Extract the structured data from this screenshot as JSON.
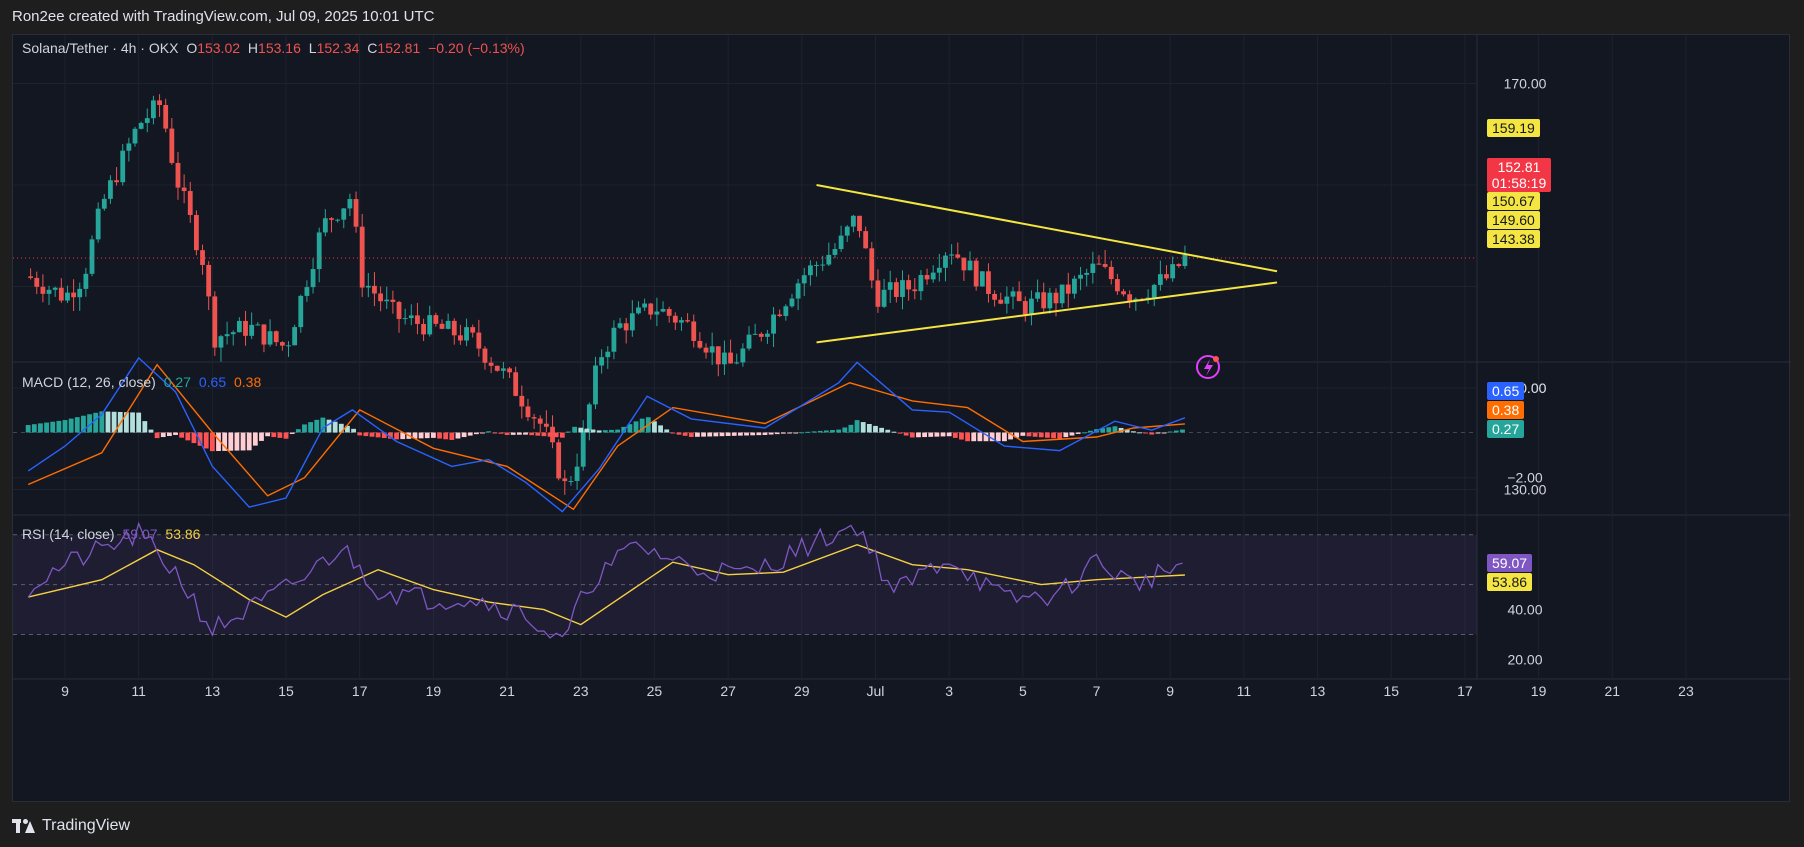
{
  "header": {
    "attribution": "Ron2ee created with TradingView.com, Jul 09, 2025 10:01 UTC"
  },
  "legend": {
    "symbol": "Solana/Tether · 4h · OKX",
    "o_label": "O",
    "o": "153.02",
    "h_label": "H",
    "h": "153.16",
    "l_label": "L",
    "l": "152.34",
    "c_label": "C",
    "c": "152.81",
    "change": "−0.20 (−0.13%)"
  },
  "macd_legend": {
    "name": "MACD (12, 26, close)",
    "hist": "0.27",
    "macd": "0.65",
    "signal": "0.38"
  },
  "rsi_legend": {
    "name": "RSI (14, close)",
    "rsi": "59.07",
    "ma": "53.86"
  },
  "price_badges": {
    "level_159": "159.19",
    "last": "152.81",
    "countdown": "01:58:19",
    "level_150": "150.67",
    "level_149": "149.60",
    "level_143": "143.38"
  },
  "macd_badges": {
    "macd": "0.65",
    "signal": "0.38",
    "hist": "0.27"
  },
  "rsi_badges": {
    "rsi": "59.07",
    "ma": "53.86"
  },
  "footer": {
    "brand": "TradingView"
  },
  "colors": {
    "up": "#26a69a",
    "down": "#ef5350",
    "triangle": "#f5e542",
    "macd": "#2962ff",
    "signal": "#ff6d00",
    "rsi": "#7e57c2",
    "rsi_ma": "#f5d142",
    "hist_up_strong": "#26a69a",
    "hist_up_weak": "#b2dfdb",
    "hist_down_strong": "#ff5252",
    "hist_down_weak": "#ffcdd2"
  },
  "chart_data": [
    {
      "type": "candlestick",
      "title": "Solana/Tether · 4h · OKX",
      "x_ticks": [
        "9",
        "11",
        "13",
        "15",
        "17",
        "19",
        "21",
        "23",
        "25",
        "27",
        "29",
        "Jul",
        "3",
        "5",
        "7",
        "9",
        "11",
        "13",
        "15",
        "17",
        "19",
        "21",
        "23"
      ],
      "y_ticks": [
        130,
        140,
        150,
        160,
        170
      ],
      "y_tick_labels": [
        "130.00",
        "140.00",
        "",
        "",
        "170.00"
      ],
      "ylim": [
        123.5,
        173
      ],
      "approx_close_path": [
        {
          "x": "Jun 8",
          "close": 151
        },
        {
          "x": "Jun 9",
          "close": 149
        },
        {
          "x": "Jun 9.5",
          "close": 151
        },
        {
          "x": "Jun 10",
          "close": 158
        },
        {
          "x": "Jun 11",
          "close": 166
        },
        {
          "x": "Jun 11.6",
          "close": 168
        },
        {
          "x": "Jun 12",
          "close": 161
        },
        {
          "x": "Jun 12.8",
          "close": 152
        },
        {
          "x": "Jun 13",
          "close": 145
        },
        {
          "x": "Jun 14",
          "close": 146
        },
        {
          "x": "Jun 15",
          "close": 144
        },
        {
          "x": "Jun 16",
          "close": 156
        },
        {
          "x": "Jun 16.8",
          "close": 159
        },
        {
          "x": "Jun 17",
          "close": 151
        },
        {
          "x": "Jun 18",
          "close": 147
        },
        {
          "x": "Jun 19",
          "close": 146
        },
        {
          "x": "Jun 20",
          "close": 145
        },
        {
          "x": "Jun 21",
          "close": 141
        },
        {
          "x": "Jun 22",
          "close": 136
        },
        {
          "x": "Jun 22.6",
          "close": 130
        },
        {
          "x": "Jun 23",
          "close": 134
        },
        {
          "x": "Jun 23.5",
          "close": 143
        },
        {
          "x": "Jun 24",
          "close": 146
        },
        {
          "x": "Jun 25",
          "close": 148
        },
        {
          "x": "Jun 26",
          "close": 146
        },
        {
          "x": "Jun 27",
          "close": 142
        },
        {
          "x": "Jun 28",
          "close": 146
        },
        {
          "x": "Jun 29",
          "close": 151
        },
        {
          "x": "Jun 30",
          "close": 154
        },
        {
          "x": "Jun 30.5",
          "close": 157
        },
        {
          "x": "Jul 1",
          "close": 149
        },
        {
          "x": "Jul 2",
          "close": 150
        },
        {
          "x": "Jul 3",
          "close": 154
        },
        {
          "x": "Jul 4",
          "close": 150
        },
        {
          "x": "Jul 5",
          "close": 148
        },
        {
          "x": "Jul 6",
          "close": 149
        },
        {
          "x": "Jul 7",
          "close": 152
        },
        {
          "x": "Jul 8",
          "close": 149
        },
        {
          "x": "Jul 9",
          "close": 151
        },
        {
          "x": "Jul 9.4",
          "close": 152.81
        }
      ],
      "trendlines": [
        {
          "name": "triangle-upper",
          "from": {
            "x": "Jun 29.4",
            "y": 160
          },
          "to": {
            "x": "Jul 11.9",
            "y": 151.5
          }
        },
        {
          "name": "triangle-lower",
          "from": {
            "x": "Jun 29.4",
            "y": 144.5
          },
          "to": {
            "x": "Jul 11.9",
            "y": 150.4
          }
        }
      ]
    },
    {
      "type": "line",
      "title": "MACD (12, 26, close)",
      "y_ticks": [
        0,
        -2
      ],
      "y_tick_labels": [
        "",
        "−2.00"
      ],
      "ylim": [
        -3.55,
        3.3
      ],
      "series": [
        {
          "name": "MACD",
          "values_path": [
            [
              -1.7,
              "Jun 8"
            ],
            [
              -0.6,
              "Jun 9"
            ],
            [
              0.8,
              "Jun 10"
            ],
            [
              3.3,
              "Jun 11"
            ],
            [
              1.8,
              "Jun 12"
            ],
            [
              -1.5,
              "Jun 13"
            ],
            [
              -3.3,
              "Jun 14"
            ],
            [
              -2.9,
              "Jun 15"
            ],
            [
              0.2,
              "Jun 16"
            ],
            [
              1.0,
              "Jun 16.8"
            ],
            [
              -0.4,
              "Jun 18"
            ],
            [
              -1.5,
              "Jun 19.5"
            ],
            [
              -1.2,
              "Jun 20.5"
            ],
            [
              -2.2,
              "Jun 21.5"
            ],
            [
              -3.5,
              "Jun 22.5"
            ],
            [
              -1.6,
              "Jun 23.5"
            ],
            [
              1.6,
              "Jun 24.8"
            ],
            [
              0.6,
              "Jun 26"
            ],
            [
              0.2,
              "Jun 28"
            ],
            [
              2.2,
              "Jun 30"
            ],
            [
              3.1,
              "Jun 30.5"
            ],
            [
              1.0,
              "Jul 2"
            ],
            [
              0.9,
              "Jul 3"
            ],
            [
              -0.6,
              "Jul 4.5"
            ],
            [
              -0.8,
              "Jul 6"
            ],
            [
              0.5,
              "Jul 7.5"
            ],
            [
              0.1,
              "Jul 8.5"
            ],
            [
              0.65,
              "Jul 9.4"
            ]
          ]
        },
        {
          "name": "Signal",
          "values_path": [
            [
              -2.3,
              "Jun 8"
            ],
            [
              -0.9,
              "Jun 10"
            ],
            [
              3.0,
              "Jun 11.5"
            ],
            [
              0.0,
              "Jun 13"
            ],
            [
              -2.8,
              "Jun 14.5"
            ],
            [
              -2.0,
              "Jun 15.5"
            ],
            [
              1.0,
              "Jun 17"
            ],
            [
              -0.7,
              "Jun 19"
            ],
            [
              -1.5,
              "Jun 21"
            ],
            [
              -3.4,
              "Jun 22.8"
            ],
            [
              -0.6,
              "Jun 24"
            ],
            [
              1.1,
              "Jun 25.5"
            ],
            [
              0.4,
              "Jun 28"
            ],
            [
              2.2,
              "Jun 30.3"
            ],
            [
              1.4,
              "Jul 2"
            ],
            [
              1.1,
              "Jul 3.5"
            ],
            [
              -0.4,
              "Jul 5"
            ],
            [
              -0.2,
              "Jul 7"
            ],
            [
              0.2,
              "Jul 8"
            ],
            [
              0.38,
              "Jul 9.4"
            ]
          ]
        }
      ]
    },
    {
      "type": "line",
      "title": "RSI (14, close)",
      "y_ticks": [
        20,
        40
      ],
      "y_tick_labels": [
        "20.00",
        "40.00"
      ],
      "bands": [
        30,
        50,
        70
      ],
      "ylim": [
        15,
        75
      ],
      "series": [
        {
          "name": "RSI",
          "values_path": [
            [
              49,
              "Jun 8"
            ],
            [
              58,
              "Jun 9"
            ],
            [
              70,
              "Jun 11"
            ],
            [
              55,
              "Jun 12"
            ],
            [
              32,
              "Jun 13"
            ],
            [
              44,
              "Jun 14.5"
            ],
            [
              53,
              "Jun 15.5"
            ],
            [
              65,
              "Jun 16.5"
            ],
            [
              48,
              "Jun 17.5"
            ],
            [
              44,
              "Jun 19"
            ],
            [
              45,
              "Jun 20"
            ],
            [
              38,
              "Jun 21.5"
            ],
            [
              26,
              "Jun 22.5"
            ],
            [
              50,
              "Jun 23.2"
            ],
            [
              66,
              "Jun 24.5"
            ],
            [
              57,
              "Jun 26"
            ],
            [
              54,
              "Jun 27.5"
            ],
            [
              68,
              "Jun 29.5"
            ],
            [
              74,
              "Jun 30.5"
            ],
            [
              47,
              "Jul 1.5"
            ],
            [
              61,
              "Jul 3"
            ],
            [
              44,
              "Jul 4.5"
            ],
            [
              46,
              "Jul 6"
            ],
            [
              60,
              "Jul 7"
            ],
            [
              50,
              "Jul 8"
            ],
            [
              59.07,
              "Jul 9.4"
            ]
          ]
        },
        {
          "name": "RSI-based MA",
          "values_path": [
            [
              45,
              "Jun 8"
            ],
            [
              52,
              "Jun 10"
            ],
            [
              64,
              "Jun 11.5"
            ],
            [
              58,
              "Jun 12.5"
            ],
            [
              44,
              "Jun 14"
            ],
            [
              37,
              "Jun 15"
            ],
            [
              46,
              "Jun 16"
            ],
            [
              56,
              "Jun 17.5"
            ],
            [
              48,
              "Jun 19"
            ],
            [
              43,
              "Jun 20.5"
            ],
            [
              40,
              "Jun 22"
            ],
            [
              34,
              "Jun 23"
            ],
            [
              44,
              "Jun 24"
            ],
            [
              59,
              "Jun 25.5"
            ],
            [
              54,
              "Jun 27"
            ],
            [
              55,
              "Jun 28.5"
            ],
            [
              66,
              "Jun 30.5"
            ],
            [
              58,
              "Jul 2"
            ],
            [
              56,
              "Jul 3.5"
            ],
            [
              50,
              "Jul 5.5"
            ],
            [
              52,
              "Jul 7"
            ],
            [
              53.86,
              "Jul 9.4"
            ]
          ]
        }
      ]
    }
  ]
}
